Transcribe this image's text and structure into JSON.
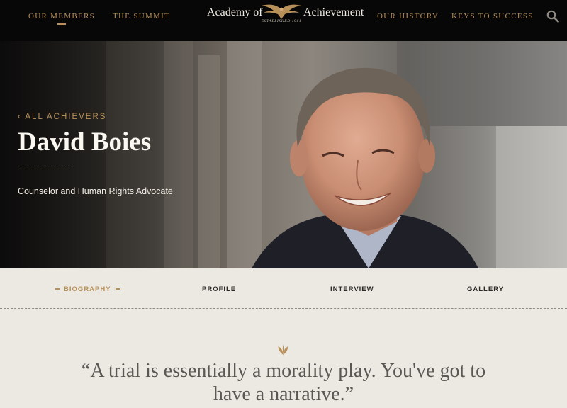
{
  "header": {
    "nav_left": [
      {
        "label": "OUR MEMBERS",
        "active": true
      },
      {
        "label": "THE SUMMIT",
        "active": false
      }
    ],
    "logo": {
      "left": "Academy of",
      "right": "Achievement",
      "established": "ESTABLISHED 1961",
      "icon": "eagle-icon"
    },
    "nav_right": [
      {
        "label": "OUR HISTORY"
      },
      {
        "label": "KEYS TO SUCCESS"
      }
    ],
    "search_icon": "search-icon"
  },
  "hero": {
    "back_icon": "chevron-left-icon",
    "back_label": "ALL ACHIEVERS",
    "name": "David Boies",
    "subtitle": "Counselor and Human Rights Advocate"
  },
  "subnav": {
    "tabs": [
      {
        "label": "BIOGRAPHY",
        "active": true
      },
      {
        "label": "PROFILE",
        "active": false
      },
      {
        "label": "INTERVIEW",
        "active": false
      },
      {
        "label": "GALLERY",
        "active": false
      }
    ]
  },
  "quote": {
    "icon": "leaf-icon",
    "text": "“A trial is essentially a morality play. You've got to have a narrative.”"
  },
  "colors": {
    "accent": "#b8905a",
    "topbar": "#070707",
    "page_bg": "#ece9e3",
    "quote_text": "#5b5854"
  }
}
